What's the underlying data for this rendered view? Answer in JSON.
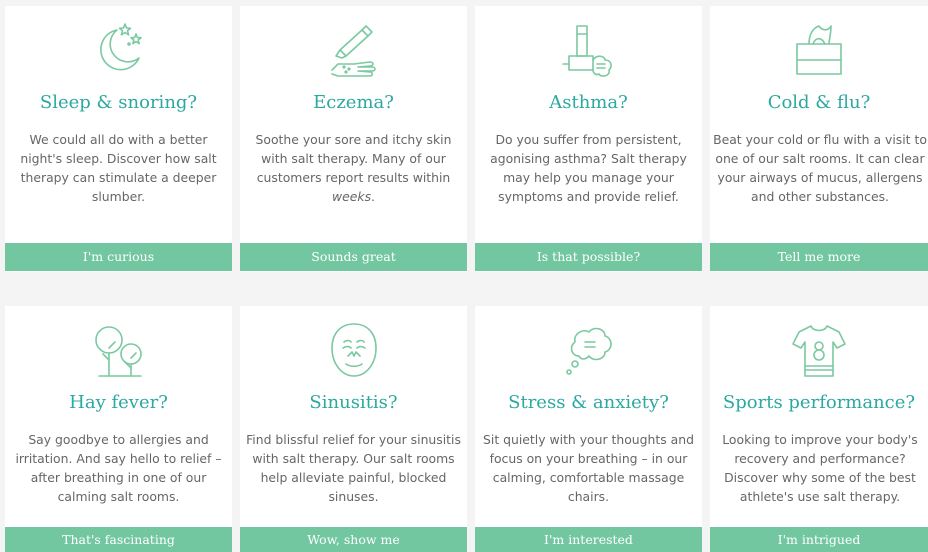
{
  "accent_color": "#72c7a0",
  "title_color": "#2ba8a0",
  "cards": [
    {
      "icon": "moon-stars-icon",
      "title": "Sleep & snoring?",
      "description": "We could all do with a better night's sleep. Discover how salt therapy can stimulate a deeper slumber.",
      "button": "I'm curious"
    },
    {
      "icon": "cream-hand-icon",
      "title": "Eczema?",
      "description_before": "Soothe your sore and itchy skin with salt therapy. Many of our customers report results within ",
      "description_emphasis": "weeks",
      "description_after": ".",
      "button": "Sounds great"
    },
    {
      "icon": "inhaler-icon",
      "title": "Asthma?",
      "description": "Do you suffer from persistent, agonising asthma? Salt therapy may help you manage your symptoms and provide relief.",
      "button": "Is that possible?"
    },
    {
      "icon": "tissue-box-icon",
      "title": "Cold & flu?",
      "description": "Beat your cold or flu with a visit to one of our salt rooms. It can clear your airways of mucus, allergens and other substances.",
      "button": "Tell me more"
    },
    {
      "icon": "trees-icon",
      "title": "Hay fever?",
      "description": "Say goodbye to allergies and irritation. And say hello to relief – after breathing in one of our calming salt rooms.",
      "button": "That's fascinating"
    },
    {
      "icon": "face-mask-icon",
      "title": "Sinusitis?",
      "description": "Find blissful relief for your sinusitis with salt therapy. Our salt rooms help alleviate painful, blocked sinuses.",
      "button": "Wow, show me"
    },
    {
      "icon": "thought-bubble-icon",
      "title": "Stress & anxiety?",
      "description": "Sit quietly with your thoughts and focus on your breathing – in our calming, comfortable massage chairs.",
      "button": "I'm interested"
    },
    {
      "icon": "sports-shirt-icon",
      "title": "Sports performance?",
      "description": "Looking to improve your body's recovery and performance? Discover why some of the best athlete's use salt therapy.",
      "button": "I'm intrigued"
    }
  ]
}
